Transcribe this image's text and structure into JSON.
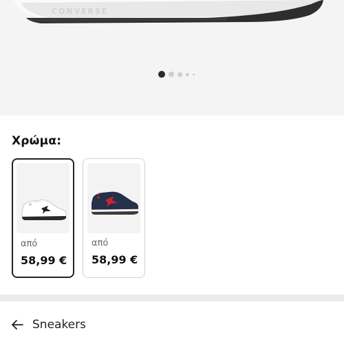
{
  "product_gallery": {
    "image_alt": "white sneaker sole",
    "brand_mark": "CONVERSE",
    "carousel": {
      "total_dots": 5,
      "active_index": 1
    }
  },
  "color_section": {
    "title": "Χρώμα:",
    "variants": [
      {
        "from_label": "από",
        "price": "58,99 €",
        "selected": true,
        "colorway": "white / black"
      },
      {
        "from_label": "από",
        "price": "58,99 €",
        "selected": false,
        "colorway": "navy / red"
      }
    ]
  },
  "breadcrumb": {
    "back_icon": "arrow-left-icon",
    "label": "Sneakers"
  },
  "colors": {
    "accent": "#222222",
    "sneaker_red": "#c9262c",
    "sneaker_navy": "#25304a"
  }
}
